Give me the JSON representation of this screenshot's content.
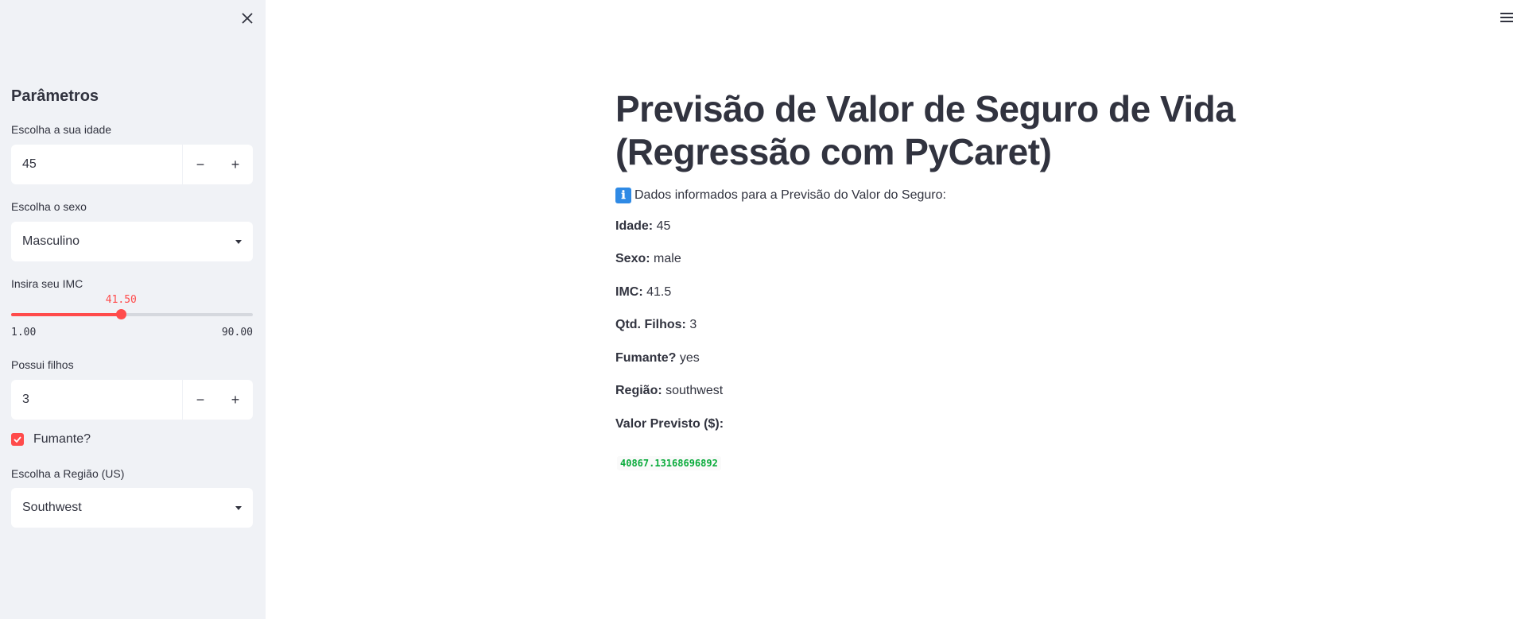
{
  "sidebar": {
    "title": "Parâmetros",
    "age": {
      "label": "Escolha a sua idade",
      "value": "45",
      "minus": "−",
      "plus": "+"
    },
    "sex": {
      "label": "Escolha o sexo",
      "value": "Masculino"
    },
    "bmi": {
      "label": "Insira seu IMC",
      "value": "41.50",
      "min": "1.00",
      "max": "90.00",
      "fraction": 0.455
    },
    "children": {
      "label": "Possui filhos",
      "value": "3",
      "minus": "−",
      "plus": "+"
    },
    "smoker": {
      "label": "Fumante?",
      "checked": true
    },
    "region": {
      "label": "Escolha a Região (US)",
      "value": "Southwest"
    }
  },
  "main": {
    "title_line1": "Previsão de Valor de Seguro de Vida",
    "title_line2": "(Regressão com PyCaret)",
    "info_icon": "ℹ",
    "info_text": "Dados informados para a Previsão do Valor do Seguro:",
    "fields": [
      {
        "key": "Idade:",
        "value": "45"
      },
      {
        "key": "Sexo:",
        "value": "male"
      },
      {
        "key": "IMC:",
        "value": "41.5"
      },
      {
        "key": "Qtd. Filhos:",
        "value": "3"
      },
      {
        "key": "Fumante?",
        "value": "yes"
      },
      {
        "key": "Região:",
        "value": "southwest"
      }
    ],
    "prediction_label": "Valor Previsto ($):",
    "prediction_value": "40867.13168696892"
  },
  "colors": {
    "accent": "#ff4b4b",
    "sidebar_bg": "#f0f2f6",
    "text": "#31333f",
    "result_green": "#09ab3b"
  }
}
